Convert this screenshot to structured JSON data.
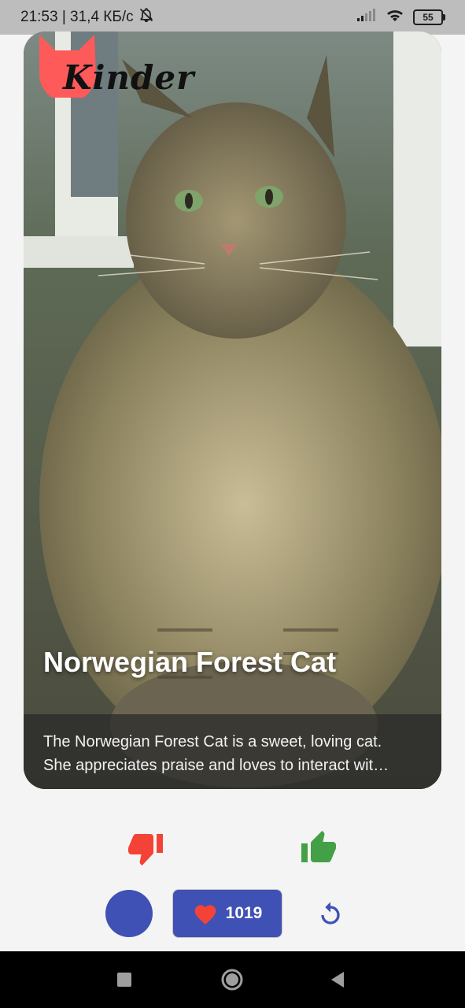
{
  "status_bar": {
    "time_speed": "21:53 | 31,4 КБ/с",
    "battery": "55",
    "icons": [
      "bell-off-icon",
      "signal-icon",
      "wifi-icon",
      "battery-icon"
    ]
  },
  "app": {
    "logo_text": "Kinder",
    "brand_color": "#ff5a5a"
  },
  "card": {
    "cat_name": "Norwegian Forest Cat",
    "description_line1": "The Norwegian Forest Cat is a sweet, loving cat.",
    "description_line2": "She appreciates praise and loves to interact wit…"
  },
  "actions": {
    "dislike_icon": "thumbs-down-icon",
    "like_icon": "thumbs-up-icon",
    "dislike_color": "#f44336",
    "like_color": "#43a047"
  },
  "bottom": {
    "likes_count": "1019",
    "accent_color": "#3f51b5",
    "theme_icon": "moon-icon",
    "likes_icon": "heart-icon",
    "refresh_icon": "refresh-icon"
  },
  "nav": {
    "icons": [
      "square-recents-icon",
      "circle-home-icon",
      "triangle-back-icon"
    ]
  }
}
